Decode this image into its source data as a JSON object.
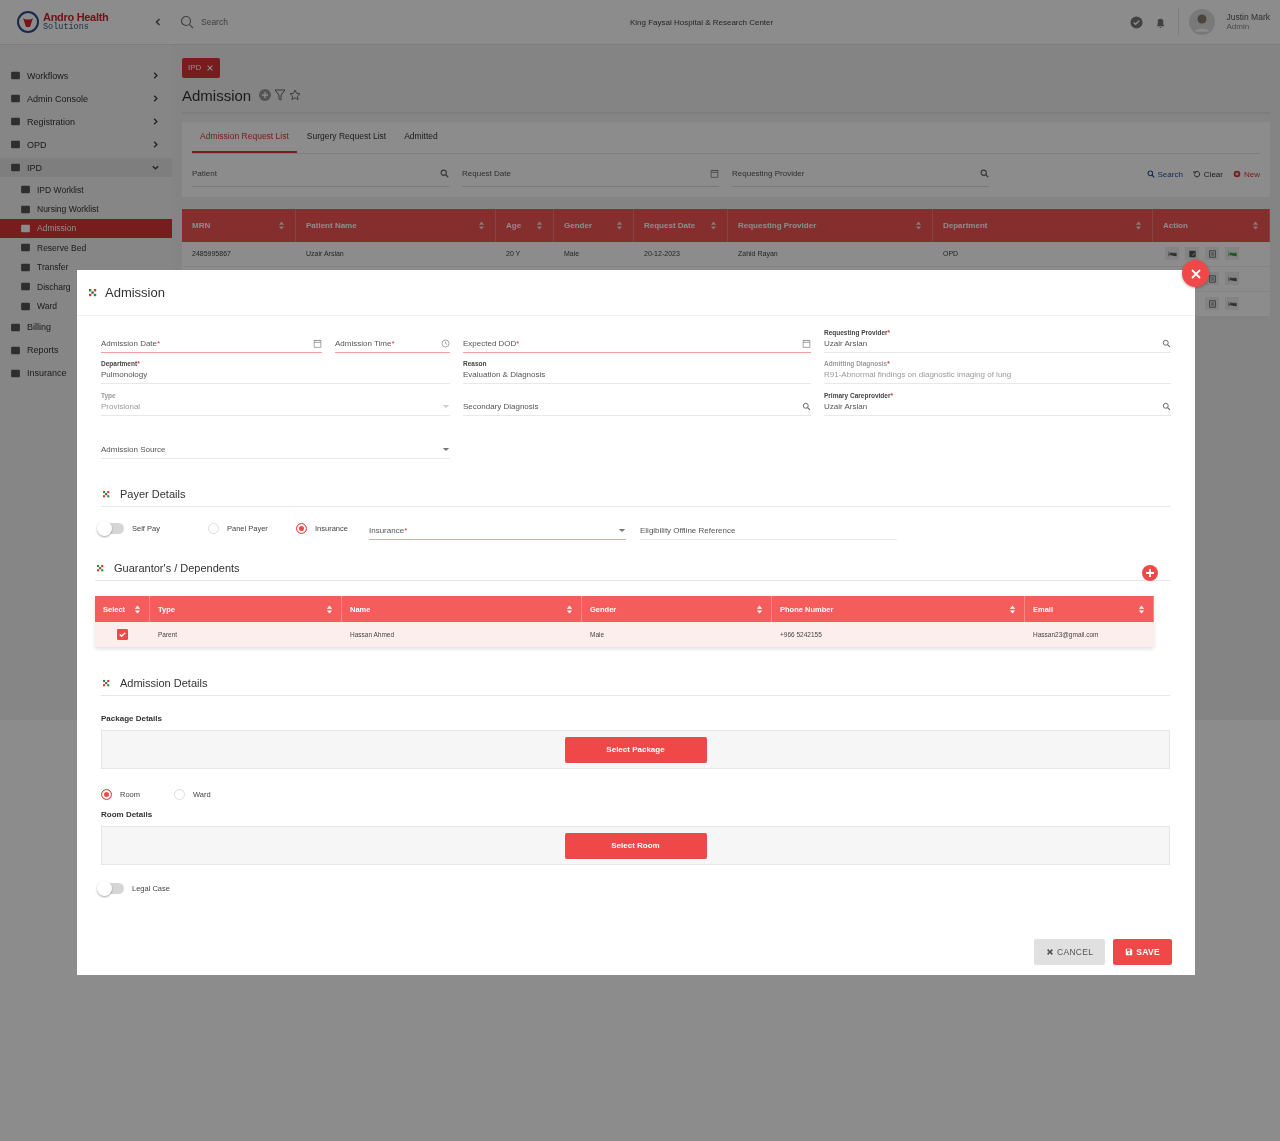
{
  "header": {
    "logo_title": "Andro Health",
    "logo_subtitle": "Solutions",
    "search_placeholder": "Search",
    "facility": "King Faysal Hospital & Research Center",
    "user_name": "Justin Mark",
    "user_role": "Admin"
  },
  "sidebar": {
    "items": [
      {
        "label": "Workflows",
        "expanded": false,
        "selected": false
      },
      {
        "label": "Admin Console",
        "expanded": false,
        "selected": false
      },
      {
        "label": "Registration",
        "expanded": false,
        "selected": false
      },
      {
        "label": "OPD",
        "expanded": false,
        "selected": false
      },
      {
        "label": "IPD",
        "expanded": true,
        "selected": false,
        "children": [
          {
            "label": "IPD Worklist",
            "selected": false
          },
          {
            "label": "Nursing Worklist",
            "selected": false
          },
          {
            "label": "Admission",
            "selected": true
          },
          {
            "label": "Reserve Bed",
            "selected": false
          },
          {
            "label": "Transfer",
            "selected": false
          },
          {
            "label": "Discharg",
            "selected": false
          },
          {
            "label": "Ward",
            "selected": false
          }
        ]
      },
      {
        "label": "Billing",
        "selected": false
      },
      {
        "label": "Reports",
        "selected": false
      },
      {
        "label": "Insurance",
        "selected": false
      }
    ]
  },
  "page": {
    "chip": "IPD",
    "title": "Admission",
    "tabs": [
      {
        "label": "Admission Request List",
        "selected": true
      },
      {
        "label": "Surgery Request List",
        "selected": false
      },
      {
        "label": "Admitted",
        "selected": false
      }
    ],
    "filters": [
      {
        "placeholder": "Patient",
        "kind": "search"
      },
      {
        "placeholder": "Request Date",
        "kind": "date"
      },
      {
        "placeholder": "Requesting Provider",
        "kind": "search"
      }
    ],
    "actions": [
      {
        "label": "Search",
        "kind": "search"
      },
      {
        "label": "Clear",
        "kind": "clear"
      },
      {
        "label": "New",
        "kind": "new"
      }
    ],
    "table": {
      "columns": [
        "MRN",
        "Patient Name",
        "Age",
        "Gender",
        "Request Date",
        "Requesting Provider",
        "Department",
        "Action"
      ],
      "rows": [
        {
          "cells": [
            "2485995867",
            "Uzair Arslan",
            "20 Y",
            "Male",
            "20-12-2023",
            "Zahid Rayan",
            "OPD"
          ],
          "actions": [
            {
              "kind": "bed",
              "highlighted": false
            },
            {
              "kind": "edit",
              "highlighted": false
            },
            {
              "kind": "doc",
              "highlighted": false
            },
            {
              "kind": "bed",
              "highlighted": true
            }
          ]
        },
        {
          "actions": [
            {
              "kind": "doc",
              "highlighted": false
            },
            {
              "kind": "bed",
              "highlighted": false
            }
          ]
        },
        {
          "actions": [
            {
              "kind": "doc",
              "highlighted": false
            },
            {
              "kind": "bed",
              "highlighted": false
            }
          ]
        }
      ]
    }
  },
  "modal": {
    "title": "Admission",
    "form_rows": [
      [
        [
          {
            "label": "Admission Date",
            "required_mark": "*",
            "kind": "date",
            "invalid": true,
            "disabled": false
          },
          {
            "label": "Admission Time",
            "required_mark": "*",
            "kind": "time",
            "invalid": true,
            "disabled": false
          }
        ],
        [
          {
            "label": "Expected DOD",
            "required_mark": "*",
            "kind": "date",
            "invalid": true,
            "disabled": false
          }
        ],
        [
          {
            "label": "Requesting Provider",
            "required_mark": "*",
            "value": "Uzair Arslan",
            "kind": "search",
            "invalid": false,
            "disabled": false
          }
        ]
      ],
      [
        [
          {
            "label": "Department",
            "required_mark": "*",
            "value": "Pulmonology",
            "kind": "text",
            "invalid": false,
            "disabled": false
          }
        ],
        [
          {
            "label": "Reason",
            "value": "Evaluation & Diagnosis",
            "kind": "text",
            "invalid": false,
            "disabled": false
          }
        ],
        [
          {
            "label": "Admitting Diagnosis",
            "required_mark": "*",
            "value": "R91-Abnormal findings on diagnostic imaging of lung",
            "kind": "text",
            "invalid": false,
            "disabled": true
          }
        ]
      ],
      [
        [
          {
            "label": "Type",
            "value": "Provisional",
            "kind": "select",
            "invalid": false,
            "disabled": true
          }
        ],
        [
          {
            "label": "Secondary Diagnosis",
            "kind": "search",
            "invalid": false,
            "disabled": false
          }
        ],
        [
          {
            "label": "Primary Careprovider",
            "required_mark": "*",
            "value": "Uzair Arslan",
            "kind": "search",
            "invalid": false,
            "disabled": false
          }
        ]
      ],
      [
        [
          {
            "label": "Admission Source",
            "kind": "select",
            "invalid": false,
            "disabled": false
          }
        ]
      ]
    ],
    "payer": {
      "title": "Payer Details",
      "options": [
        {
          "kind": "toggle",
          "label": "Self Pay",
          "on": false
        },
        {
          "kind": "radio",
          "label": "Panel Payer",
          "selected": false
        },
        {
          "kind": "radio",
          "label": "Insurance",
          "selected": true
        }
      ],
      "fields": [
        {
          "label": "Insurance",
          "required_mark": "*",
          "kind": "select",
          "invalid": true,
          "disabled": false
        },
        {
          "label": "Eligibility Offline Reference",
          "kind": "text",
          "invalid": false,
          "disabled": false
        }
      ]
    },
    "guarantors": {
      "title": "Guarantor's / Dependents",
      "columns": [
        "Select",
        "Type",
        "Name",
        "Gender",
        "Phone Number",
        "Email"
      ],
      "rows": [
        {
          "checked": true,
          "cells": [
            "",
            "Parent",
            "Hassan Ahmed",
            "Male",
            "+966 5242155",
            "Hassan23@gmail.com"
          ]
        }
      ]
    },
    "details": {
      "title": "Admission Details",
      "package_label": "Package Details",
      "package_button": "Select Package",
      "options": [
        {
          "label": "Room",
          "selected": true
        },
        {
          "label": "Ward",
          "selected": false
        }
      ],
      "room_label": "Room Details",
      "room_button": "Select Room",
      "legal": {
        "label": "Legal Case",
        "on": false
      }
    },
    "buttons": [
      {
        "label": "CANCEL",
        "kind": "cancel"
      },
      {
        "label": "SAVE",
        "kind": "save"
      }
    ]
  }
}
